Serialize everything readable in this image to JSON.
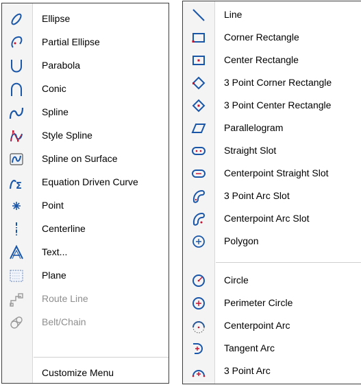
{
  "left_menu": {
    "items": [
      {
        "label": "Ellipse",
        "icon": "ellipse-icon"
      },
      {
        "label": "Partial Ellipse",
        "icon": "partial-ellipse-icon"
      },
      {
        "label": "Parabola",
        "icon": "parabola-icon"
      },
      {
        "label": "Conic",
        "icon": "conic-icon"
      },
      {
        "label": "Spline",
        "icon": "spline-icon"
      },
      {
        "label": "Style Spline",
        "icon": "style-spline-icon"
      },
      {
        "label": "Spline on Surface",
        "icon": "spline-on-surface-icon"
      },
      {
        "label": "Equation Driven Curve",
        "icon": "equation-driven-curve-icon"
      },
      {
        "label": "Point",
        "icon": "point-icon"
      },
      {
        "label": "Centerline",
        "icon": "centerline-icon"
      },
      {
        "label": "Text...",
        "icon": "text-icon"
      },
      {
        "label": "Plane",
        "icon": "plane-icon"
      },
      {
        "label": "Route Line",
        "icon": "route-line-icon",
        "disabled": true
      },
      {
        "label": "Belt/Chain",
        "icon": "belt-chain-icon",
        "disabled": true
      }
    ],
    "footer": {
      "label": "Customize Menu"
    }
  },
  "right_menu": {
    "items": [
      {
        "label": "Line",
        "icon": "line-icon"
      },
      {
        "label": "Corner Rectangle",
        "icon": "corner-rectangle-icon"
      },
      {
        "label": "Center Rectangle",
        "icon": "center-rectangle-icon"
      },
      {
        "label": "3 Point Corner Rectangle",
        "icon": "3-point-corner-rectangle-icon"
      },
      {
        "label": "3 Point Center Rectangle",
        "icon": "3-point-center-rectangle-icon"
      },
      {
        "label": "Parallelogram",
        "icon": "parallelogram-icon"
      },
      {
        "label": "Straight Slot",
        "icon": "straight-slot-icon"
      },
      {
        "label": "Centerpoint Straight Slot",
        "icon": "centerpoint-straight-slot-icon"
      },
      {
        "label": "3 Point Arc Slot",
        "icon": "3-point-arc-slot-icon"
      },
      {
        "label": "Centerpoint Arc Slot",
        "icon": "centerpoint-arc-slot-icon"
      },
      {
        "label": "Polygon",
        "icon": "polygon-icon"
      },
      {
        "label": "Circle",
        "icon": "circle-icon"
      },
      {
        "label": "Perimeter Circle",
        "icon": "perimeter-circle-icon"
      },
      {
        "label": "Centerpoint Arc",
        "icon": "centerpoint-arc-icon"
      },
      {
        "label": "Tangent Arc",
        "icon": "tangent-arc-icon"
      },
      {
        "label": "3 Point Arc",
        "icon": "3-point-arc-icon"
      }
    ]
  },
  "colors": {
    "icon_blue": "#1a56a8",
    "icon_red": "#c8102e",
    "disabled": "#8e8e8e",
    "gutter": "#f4f4f4"
  }
}
